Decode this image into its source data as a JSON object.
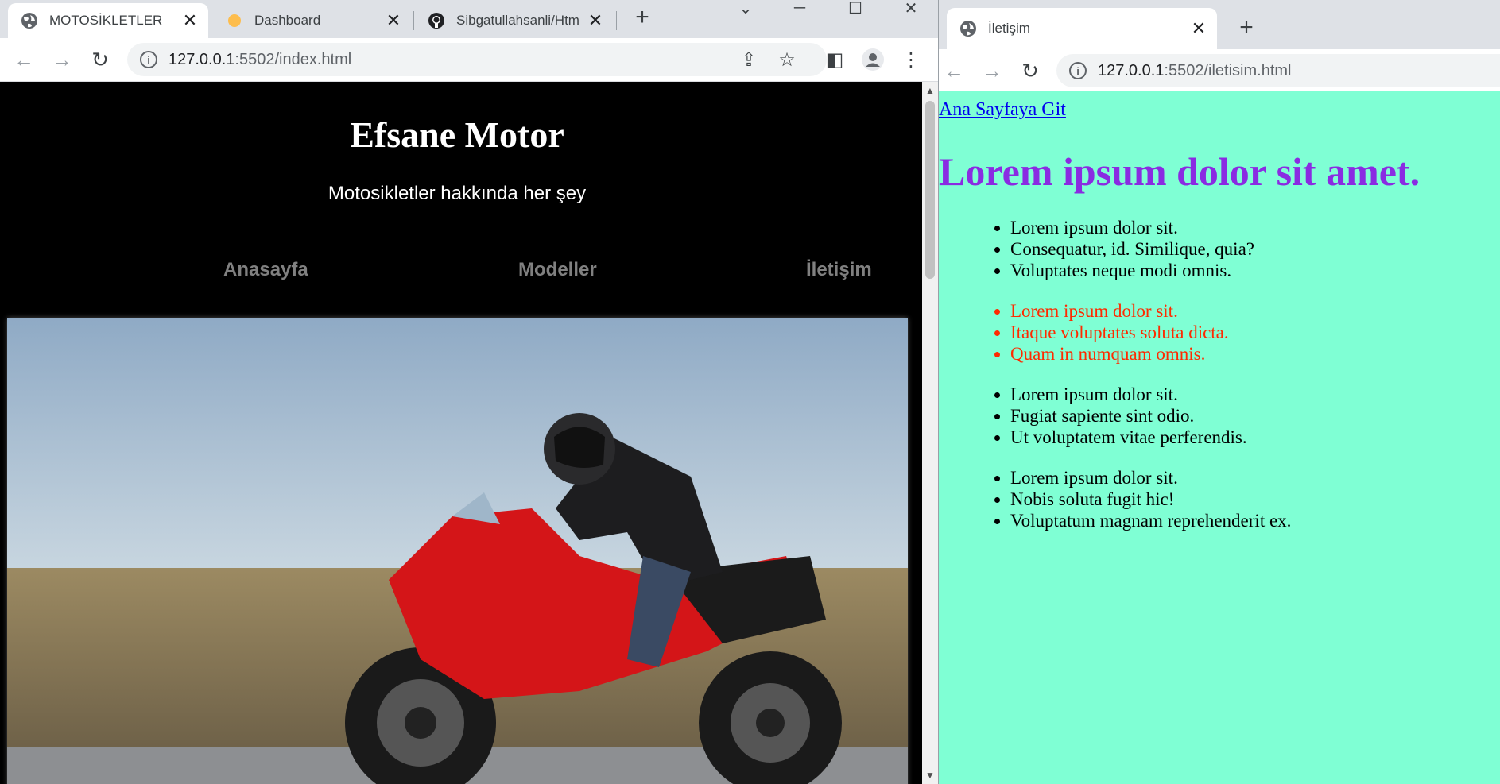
{
  "left_window": {
    "tabs": [
      {
        "title": "MOTOSİKLETLER",
        "active": true
      },
      {
        "title": "Dashboard",
        "active": false
      },
      {
        "title": "Sibgatullahsanli/Htm",
        "active": false
      }
    ],
    "url_host": "127.0.0.1",
    "url_path": ":5502/index.html",
    "page": {
      "title": "Efsane Motor",
      "subtitle": "Motosikletler hakkında her şey",
      "nav": [
        "Anasayfa",
        "Modeller",
        "İletişim"
      ]
    }
  },
  "right_window": {
    "tabs": [
      {
        "title": "İletişim",
        "active": true
      }
    ],
    "url_host": "127.0.0.1",
    "url_path": ":5502/iletisim.html",
    "page": {
      "home_link": "Ana Sayfaya Git",
      "heading": "Lorem ipsum dolor sit amet.",
      "lists": [
        {
          "color": "#000000",
          "items": [
            "Lorem ipsum dolor sit.",
            "Consequatur, id. Similique, quia?",
            "Voluptates neque modi omnis."
          ]
        },
        {
          "color": "#ff2a00",
          "items": [
            "Lorem ipsum dolor sit.",
            "Itaque voluptates soluta dicta.",
            "Quam in numquam omnis."
          ]
        },
        {
          "color": "#000000",
          "items": [
            "Lorem ipsum dolor sit.",
            "Fugiat sapiente sint odio.",
            "Ut voluptatem vitae perferendis."
          ]
        },
        {
          "color": "#000000",
          "items": [
            "Lorem ipsum dolor sit.",
            "Nobis soluta fugit hic!",
            "Voluptatum magnam reprehenderit ex."
          ]
        }
      ]
    }
  },
  "colors": {
    "page_bg_left": "#000000",
    "page_bg_right": "#7fffd4",
    "heading_purple": "#8a2be2",
    "nav_gray": "#808080",
    "link_blue": "#0000ee"
  }
}
